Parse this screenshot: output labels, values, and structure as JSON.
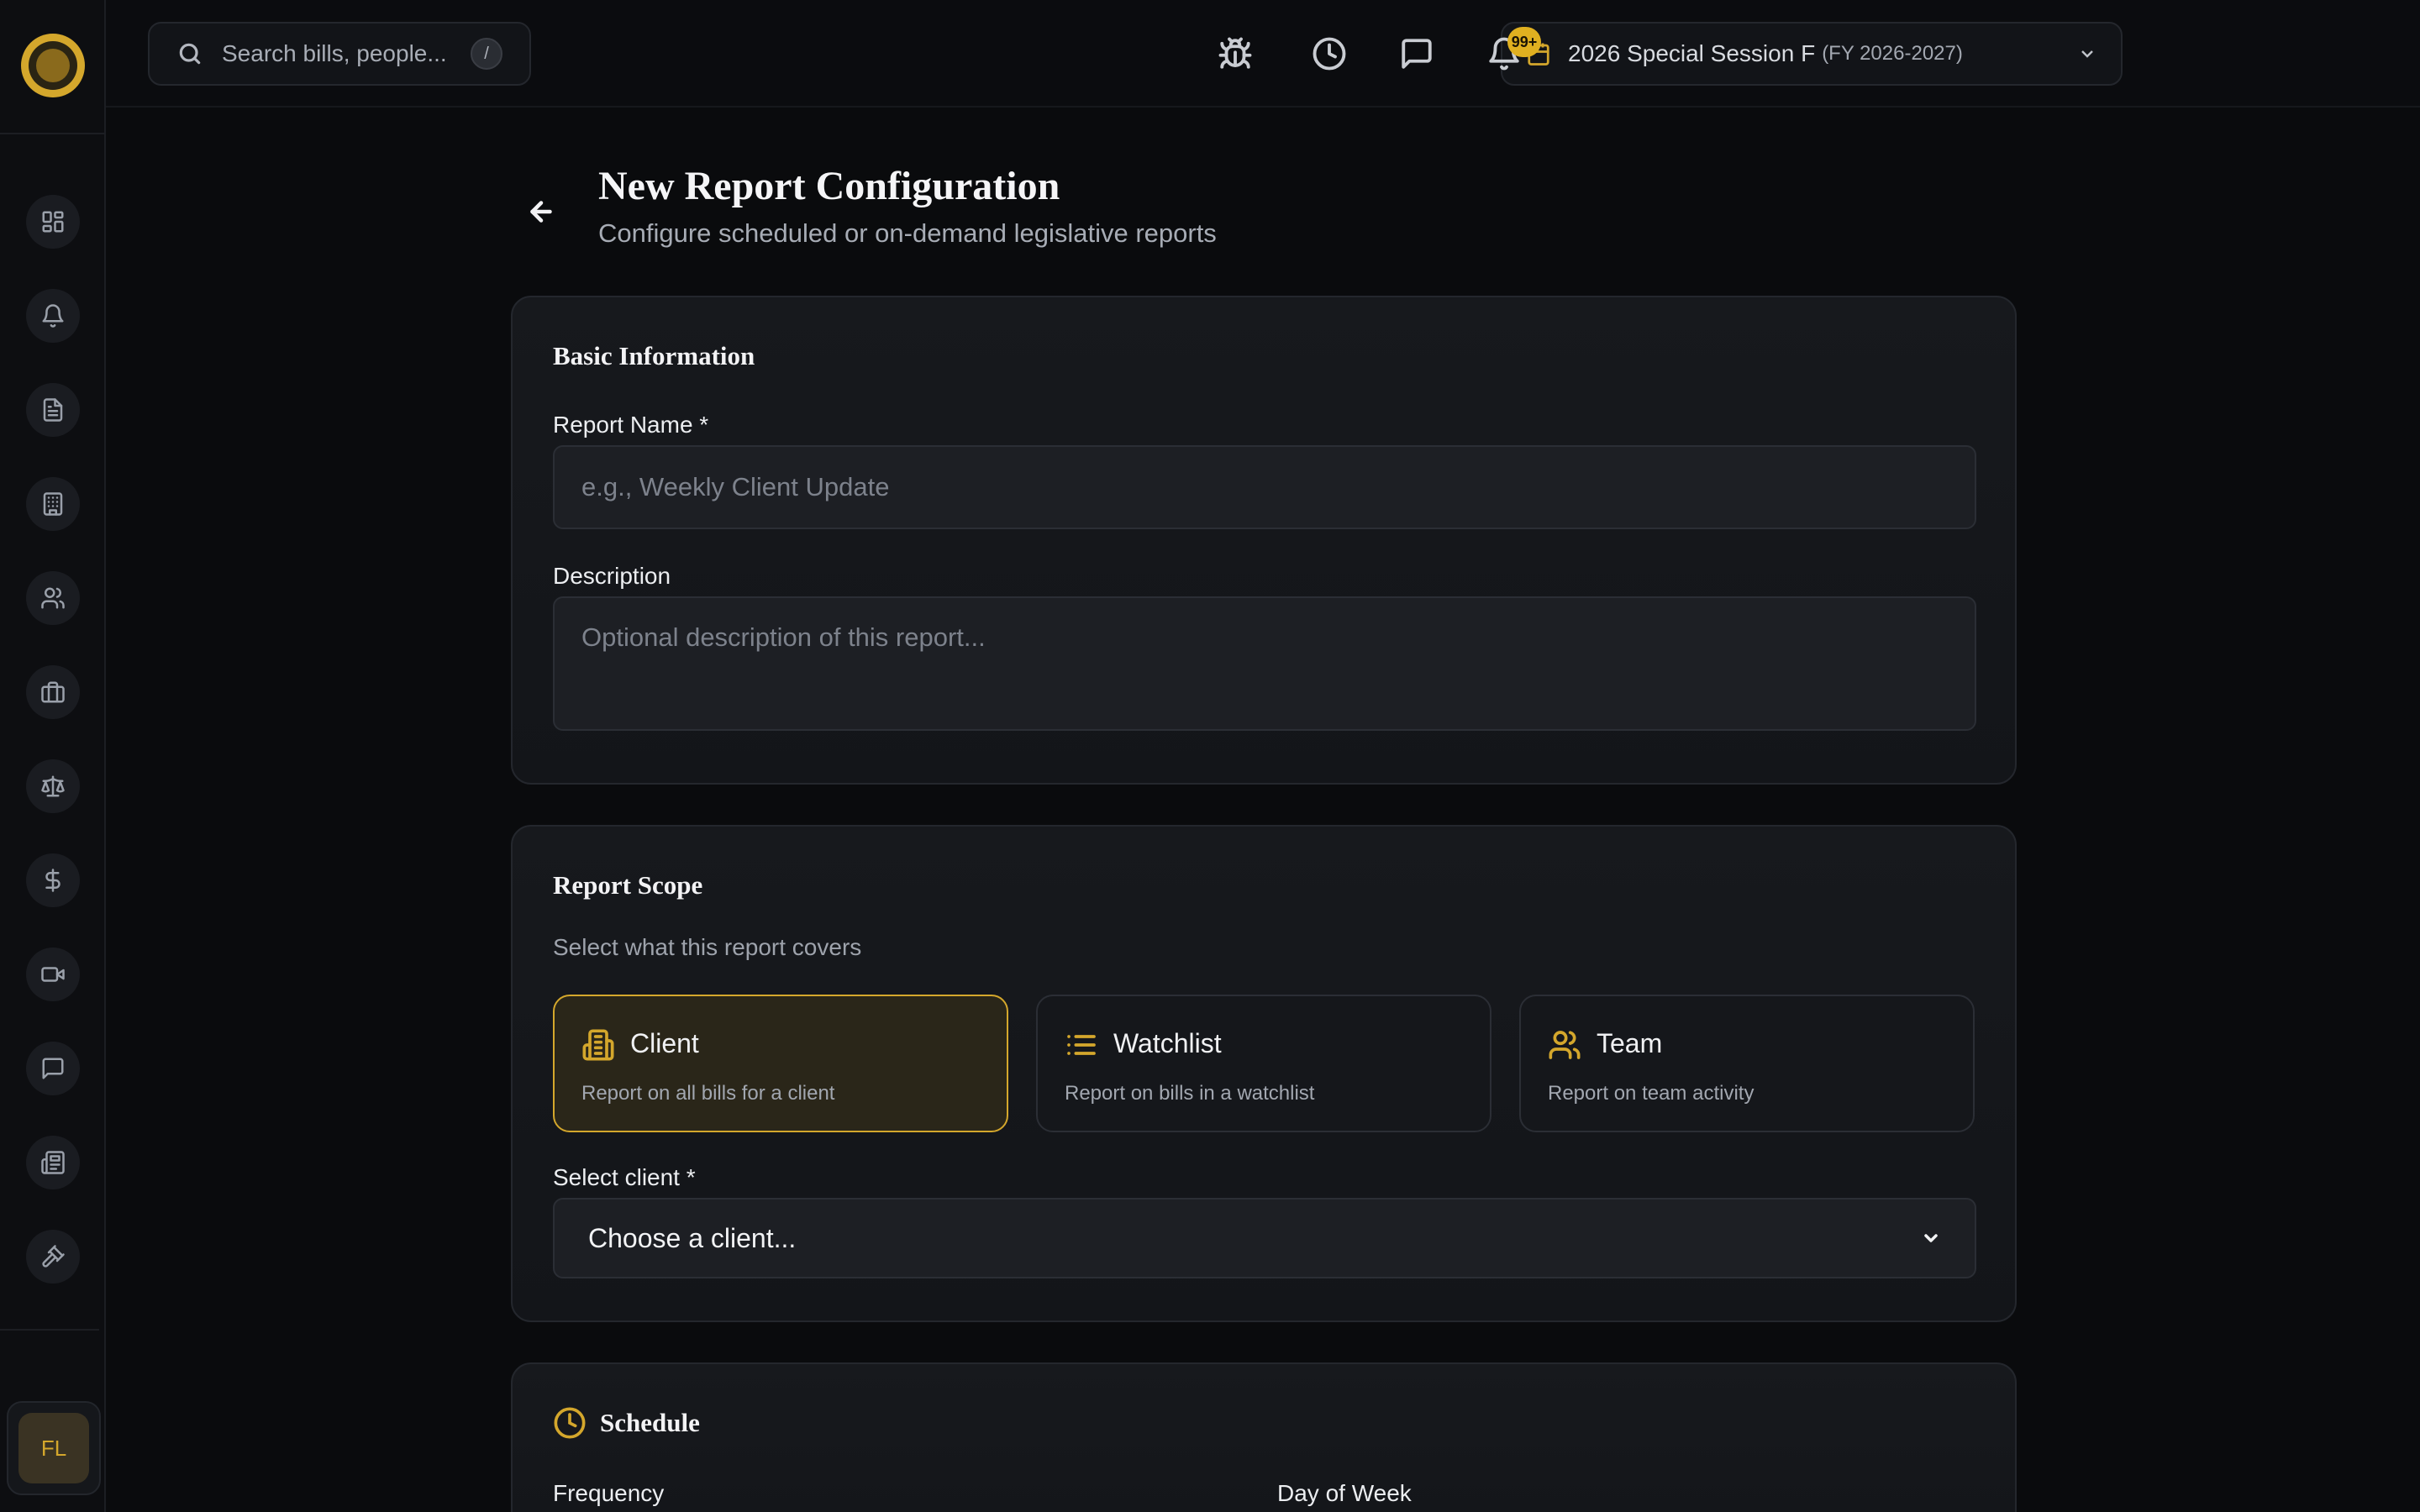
{
  "topbar": {
    "search_placeholder": "Search bills, people...",
    "search_shortcut": "/",
    "session_name": "2026 Special Session F",
    "session_fy": "(FY 2026-2027)",
    "notification_count": "99+"
  },
  "sidebar": {
    "items": [
      {
        "icon": "dashboard-icon"
      },
      {
        "icon": "bell-icon"
      },
      {
        "icon": "document-icon"
      },
      {
        "icon": "building-icon"
      },
      {
        "icon": "users-icon"
      },
      {
        "icon": "briefcase-icon"
      },
      {
        "icon": "scale-icon"
      },
      {
        "icon": "dollar-icon"
      },
      {
        "icon": "video-icon"
      },
      {
        "icon": "message-icon"
      },
      {
        "icon": "newspaper-icon"
      },
      {
        "icon": "gavel-icon"
      }
    ],
    "user_initials": "FL"
  },
  "page": {
    "title": "New Report Configuration",
    "subtitle": "Configure scheduled or on-demand legislative reports"
  },
  "basic": {
    "title": "Basic Information",
    "name_label": "Report Name *",
    "name_placeholder": "e.g., Weekly Client Update",
    "desc_label": "Description",
    "desc_placeholder": "Optional description of this report..."
  },
  "scope": {
    "title": "Report Scope",
    "subtitle": "Select what this report covers",
    "options": [
      {
        "title": "Client",
        "desc": "Report on all bills for a client",
        "selected": true
      },
      {
        "title": "Watchlist",
        "desc": "Report on bills in a watchlist",
        "selected": false
      },
      {
        "title": "Team",
        "desc": "Report on team activity",
        "selected": false
      }
    ],
    "select_label": "Select client *",
    "select_value": "Choose a client..."
  },
  "schedule": {
    "title": "Schedule",
    "frequency_label": "Frequency",
    "day_label": "Day of Week"
  },
  "colors": {
    "accent": "#d4a72c",
    "background": "#0a0b0d",
    "card": "#17191d"
  }
}
